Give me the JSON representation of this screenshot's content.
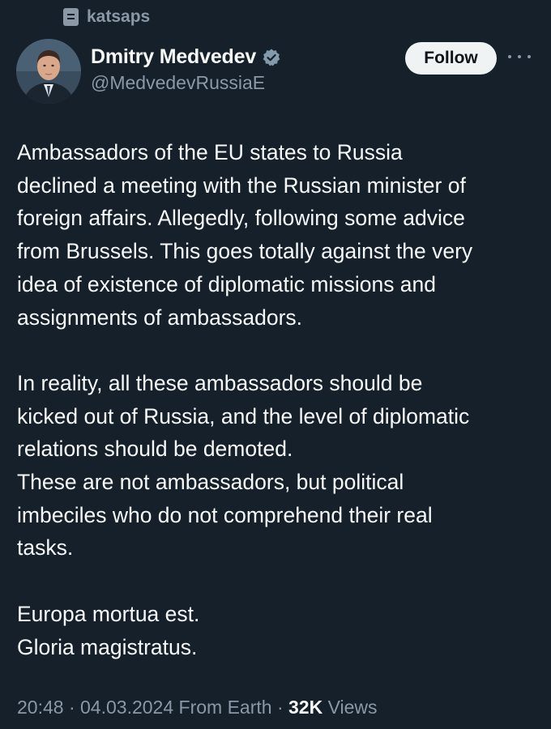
{
  "context": {
    "list_name": "katsaps",
    "icon": "list-icon"
  },
  "author": {
    "display_name": "Dmitry Medvedev",
    "handle": "@MedvedevRussiaE",
    "verified_icon": "verified-badge-icon",
    "avatar_icon": "avatar-photo"
  },
  "actions": {
    "follow_label": "Follow",
    "more_icon": "more-options-icon"
  },
  "tweet": {
    "lines": [
      "Ambassadors of the EU states to Russia",
      "declined a meeting with the Russian minister of",
      "foreign affairs. Allegedly, following some advice",
      "from Brussels. This goes totally against the very",
      "idea of existence of diplomatic missions and",
      "assignments of ambassadors.",
      "",
      "In reality, all these ambassadors should be",
      "kicked out of Russia, and the level of diplomatic",
      "relations should be demoted.",
      "These are not ambassadors, but political",
      "imbeciles who do not comprehend their real",
      "tasks.",
      "",
      "Europa mortua est.",
      "Gloria magistratus."
    ]
  },
  "meta": {
    "time": "20:48",
    "separator": " · ",
    "date": "04.03.2024",
    "source": "From Earth",
    "views_count": "32K",
    "views_label": " Views"
  },
  "colors": {
    "background": "#15202b",
    "text_primary": "#f7f9f9",
    "text_secondary": "#8b98a5",
    "verified": "#829aab",
    "follow_bg": "#eff3f4"
  }
}
